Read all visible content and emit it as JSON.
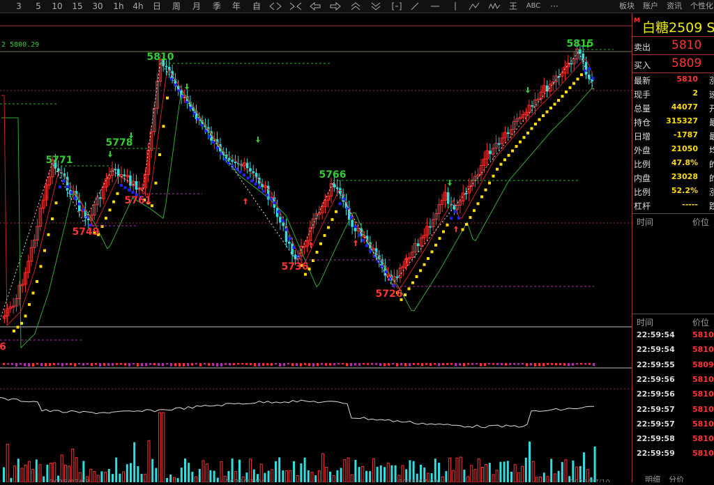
{
  "toolbar": {
    "periods": [
      "3",
      "5",
      "10",
      "15",
      "30",
      "1h",
      "4h",
      "日",
      "周",
      "月",
      "季",
      "年",
      "自"
    ],
    "icons": [
      "expand-arrows-icon",
      "collapse-arrows-icon",
      "arrow-left-icon",
      "arrow-right-icon",
      "double-up-icon",
      "double-down-icon",
      "fit-icon",
      "draw-line-icon",
      "horizontal-line-icon",
      "vertical-line-icon",
      "polyline-icon",
      "wave-icon",
      "fib-icon",
      "abc-icon",
      "more-icon"
    ],
    "abc_label": "ABC",
    "fib_label": "王",
    "more_label": "···",
    "right_menu": [
      "板块",
      "账户",
      "资讯",
      "个性化"
    ]
  },
  "chart": {
    "ma_label": "2 5800.29",
    "peak_labels": [
      {
        "text": "5810",
        "color": "#3c3"
      },
      {
        "text": "5771",
        "color": "#3c3"
      },
      {
        "text": "5778",
        "color": "#3c3"
      },
      {
        "text": "5749",
        "color": "#f33"
      },
      {
        "text": "5761",
        "color": "#f33"
      },
      {
        "text": "5766",
        "color": "#3c3"
      },
      {
        "text": "5736",
        "color": "#f33"
      },
      {
        "text": "5726",
        "color": "#f33"
      },
      {
        "text": "5815",
        "color": "#3c3"
      },
      {
        "text": "6",
        "color": "#f33"
      }
    ],
    "date_labels": [
      "2025/07/08",
      "2025/07/04",
      "2025/07/09",
      "2025/07/10"
    ],
    "colors": {
      "up": "#f33",
      "down": "#3dd",
      "yellow": "#fd0",
      "blue": "#22f",
      "ma_green": "#3a3",
      "ma_red": "#c22",
      "axis": "#a33"
    }
  },
  "panel": {
    "badge": "M",
    "title": "白糖2509",
    "title_suffix": "S",
    "ask_label": "卖出",
    "ask_price": "5810",
    "bid_label": "买入",
    "bid_price": "5809",
    "stats": [
      {
        "label": "最新",
        "value": "5810",
        "color": "#f33",
        "cut": "涨"
      },
      {
        "label": "现手",
        "value": "2",
        "color": "#fd0",
        "cut": "速"
      },
      {
        "label": "总量",
        "value": "44077",
        "color": "#fd0",
        "cut": "开"
      },
      {
        "label": "持仓",
        "value": "315327",
        "color": "#fd0",
        "cut": "最"
      },
      {
        "label": "日增",
        "value": "-1787",
        "color": "#fd0",
        "cut": "最"
      },
      {
        "label": "外盘",
        "value": "21050",
        "color": "#fd0",
        "cut": "均"
      },
      {
        "label": "比例",
        "value": "47.8%",
        "color": "#fd0",
        "cut": "的"
      },
      {
        "label": "内盘",
        "value": "23028",
        "color": "#fd0",
        "cut": "的"
      },
      {
        "label": "比例",
        "value": "52.2%",
        "color": "#fd0",
        "cut": "涨"
      },
      {
        "label": "杠杆",
        "value": "-----",
        "color": "#fd0",
        "cut": "跌"
      }
    ],
    "sec1_time": "时间",
    "sec1_price": "价位",
    "sec2_time": "时间",
    "sec2_price": "价位",
    "ticks": [
      {
        "time": "22:59:54",
        "price": "5810"
      },
      {
        "time": "22:59:54",
        "price": "5810"
      },
      {
        "time": "22:59:55",
        "price": "5809"
      },
      {
        "time": "22:59:56",
        "price": "5810"
      },
      {
        "time": "22:59:56",
        "price": "5810"
      },
      {
        "time": "22:59:57",
        "price": "5810"
      },
      {
        "time": "22:59:57",
        "price": "5810"
      },
      {
        "time": "22:59:58",
        "price": "5810"
      },
      {
        "time": "22:59:59",
        "price": "5810"
      }
    ],
    "bottom_tabs": [
      "明细",
      "分价"
    ]
  }
}
